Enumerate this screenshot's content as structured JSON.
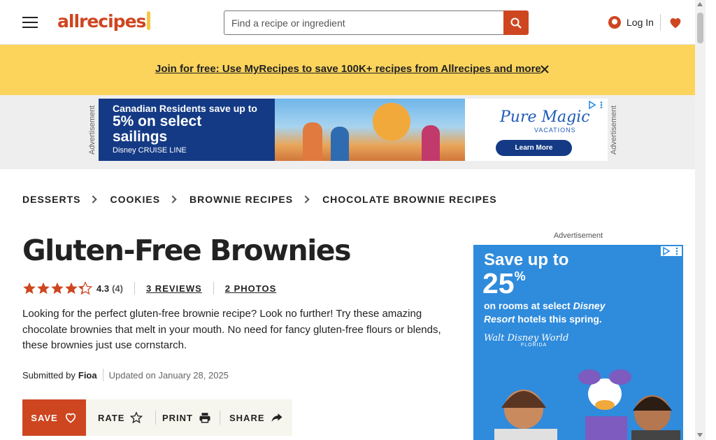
{
  "header": {
    "logo_text": "allrecipes",
    "search_placeholder": "Find a recipe or ingredient",
    "login_label": "Log In"
  },
  "promo": {
    "link_text": "Join for free: Use MyRecipes to save 100K+ recipes from Allrecipes and more"
  },
  "top_ad": {
    "side_label": "Advertisement",
    "line1": "Canadian Residents save up to",
    "line2": "5% on select",
    "line3": "sailings",
    "footer": "Disney CRUISE LINE",
    "brand": "Pure Magic",
    "brand_sub": "VACATIONS",
    "cta": "Learn More"
  },
  "breadcrumbs": [
    "DESSERTS",
    "COOKIES",
    "BROWNIE RECIPES",
    "CHOCOLATE BROWNIE RECIPES"
  ],
  "article": {
    "title": "Gluten-Free Brownies",
    "rating_value": "4.3",
    "rating_count": "(4)",
    "reviews_link": "3 REVIEWS",
    "photos_link": "2 PHOTOS",
    "description": "Looking for the perfect gluten-free brownie recipe? Look no further! Try these amazing chocolate brownies that melt in your mouth. No need for fancy gluten-free flours or blends, these brownies just use cornstarch.",
    "submitted_by_label": "Submitted by",
    "author": "Fioa",
    "updated": "Updated on January 28, 2025"
  },
  "actions": {
    "save": "SAVE",
    "rate": "RATE",
    "print": "PRINT",
    "share": "SHARE"
  },
  "side_ad": {
    "label": "Advertisement",
    "headline": "Save up to",
    "big_number": "25",
    "big_suffix": "%",
    "body_pre": "on rooms at select ",
    "body_em": "Disney Resort",
    "body_post": " hotels this spring.",
    "wdw": "Walt Disney World",
    "wdw_sub": "FLORIDA"
  },
  "colors": {
    "brand_orange": "#ce4620",
    "promo_yellow": "#fcd45c",
    "star_orange": "#ce4620"
  },
  "icons": [
    "hamburger-menu-icon",
    "search-icon",
    "user-icon",
    "heart-icon",
    "close-icon",
    "chevron-right-icon",
    "star-icon",
    "print-icon",
    "share-icon"
  ]
}
